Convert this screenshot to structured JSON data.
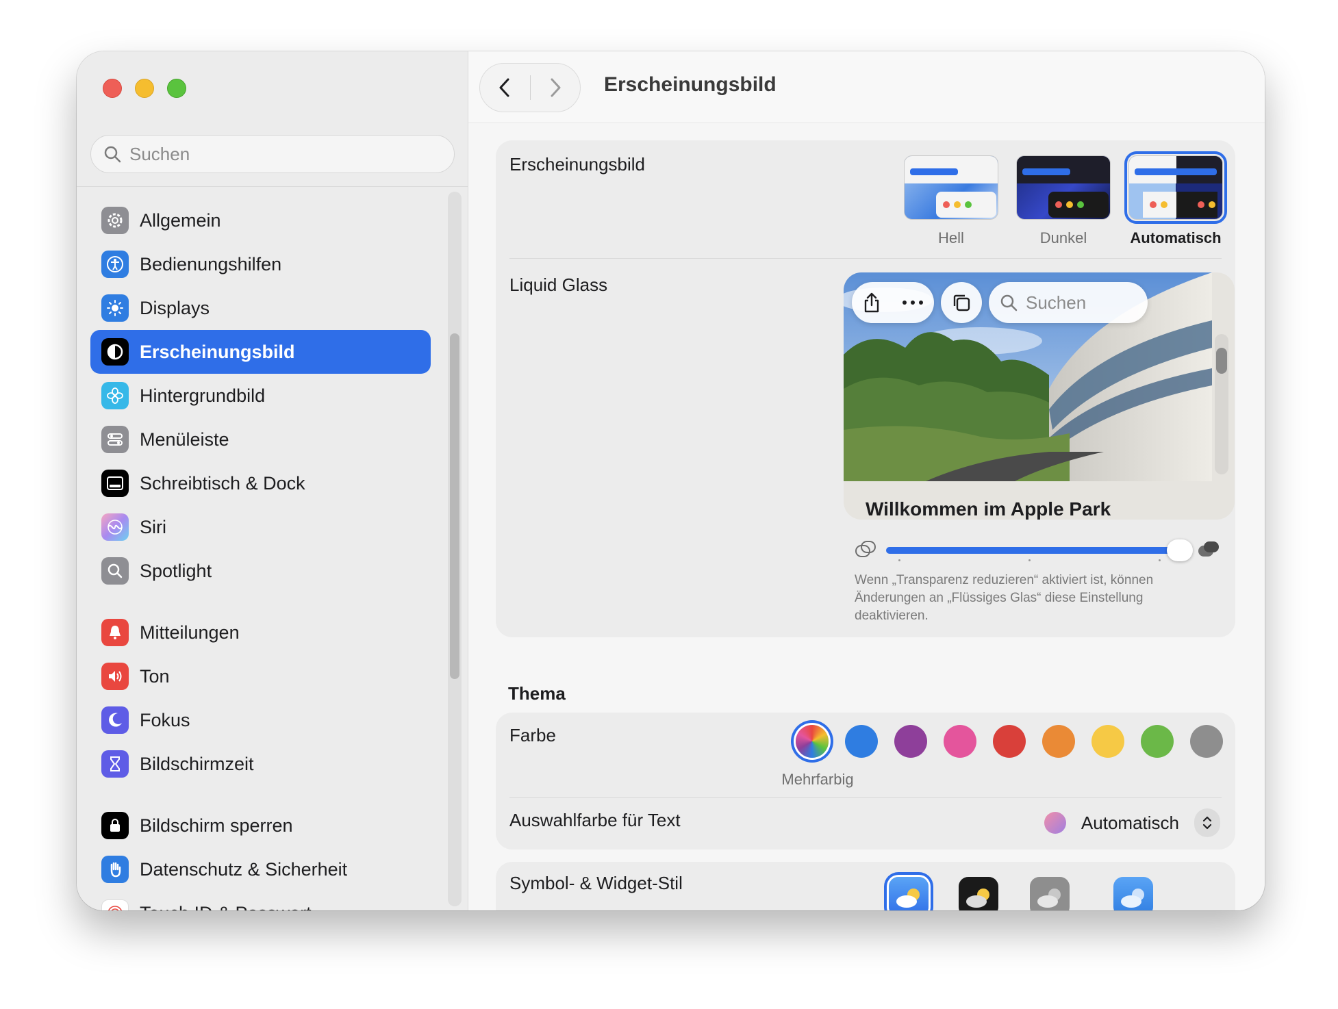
{
  "window": {
    "title": "Erscheinungsbild"
  },
  "sidebar": {
    "search_placeholder": "Suchen",
    "items": [
      {
        "label": "Allgemein",
        "icon": "gear-icon",
        "color": "#8e8e93"
      },
      {
        "label": "Bedienungshilfen",
        "icon": "accessibility-icon",
        "color": "#2f7de1"
      },
      {
        "label": "Displays",
        "icon": "sun-icon",
        "color": "#2f7de1"
      },
      {
        "label": "Erscheinungsbild",
        "icon": "appearance-icon",
        "color": "#000000"
      },
      {
        "label": "Hintergrundbild",
        "icon": "flower-icon",
        "color": "#36b8e8"
      },
      {
        "label": "Menüleiste",
        "icon": "menubar-icon",
        "color": "#8e8e93"
      },
      {
        "label": "Schreibtisch & Dock",
        "icon": "dock-icon",
        "color": "#000000"
      },
      {
        "label": "Siri",
        "icon": "siri-icon",
        "color": "#e68fb4"
      },
      {
        "label": "Spotlight",
        "icon": "magnifier-icon",
        "color": "#8e8e93"
      },
      {
        "label": "Mitteilungen",
        "icon": "bell-icon",
        "color": "#e9473f"
      },
      {
        "label": "Ton",
        "icon": "speaker-icon",
        "color": "#e9473f"
      },
      {
        "label": "Fokus",
        "icon": "moon-icon",
        "color": "#5e5ce6"
      },
      {
        "label": "Bildschirmzeit",
        "icon": "hourglass-icon",
        "color": "#5e5ce6"
      },
      {
        "label": "Bildschirm sperren",
        "icon": "lock-icon",
        "color": "#000000"
      },
      {
        "label": "Datenschutz & Sicherheit",
        "icon": "hand-icon",
        "color": "#2f7de1"
      },
      {
        "label": "Touch ID & Passwort",
        "icon": "fingerprint-icon",
        "color": "#ffffff"
      }
    ],
    "active_index": 3
  },
  "main": {
    "title": "Erscheinungsbild",
    "appearance": {
      "label": "Erscheinungsbild",
      "options": [
        "Hell",
        "Dunkel",
        "Automatisch"
      ],
      "selected": "Automatisch"
    },
    "liquid_glass": {
      "label": "Liquid Glass",
      "preview_search": "Suchen",
      "preview_title": "Willkommen im Apple Park",
      "slider_value": 0.9,
      "note": "Wenn „Transparenz reduzieren“ aktiviert ist, können Änderungen an „Flüssiges Glas“ diese Einstellung deaktivieren."
    },
    "theme": {
      "section_title": "Thema",
      "color_label": "Farbe",
      "selected_color_name": "Mehrfarbig",
      "colors": [
        "multicolor",
        "#2f7de1",
        "#8e3f9a",
        "#e4559c",
        "#d9403a",
        "#ea8a36",
        "#f6c945",
        "#6bb848",
        "#8e8e8e"
      ],
      "highlight_label": "Auswahlfarbe für Text",
      "highlight_value": "Automatisch"
    },
    "widget_style": {
      "label": "Symbol- & Widget-Stil"
    }
  }
}
